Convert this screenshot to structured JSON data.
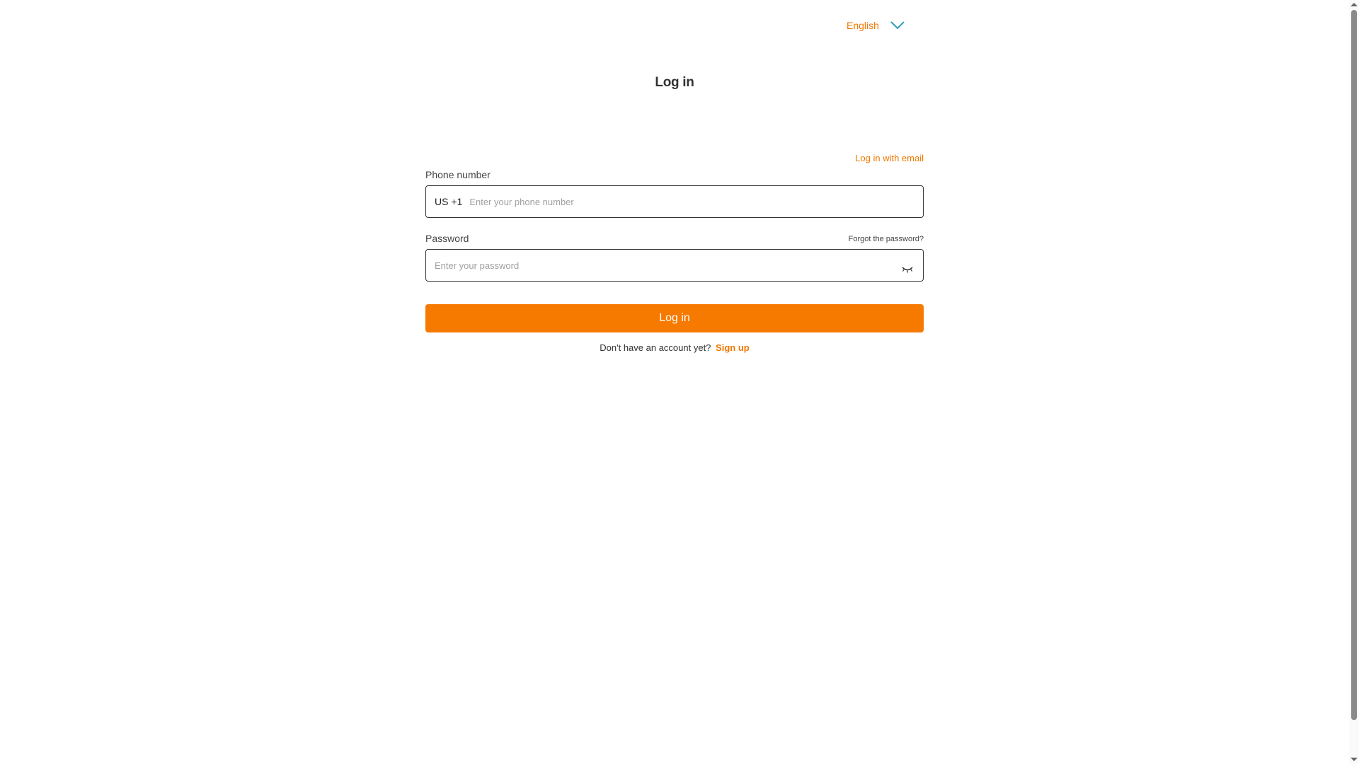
{
  "header": {
    "language": "English"
  },
  "title": "Log in",
  "form": {
    "switch_link": "Log in with email",
    "phone": {
      "label": "Phone number",
      "country_code": "US +1",
      "placeholder": "Enter your phone number",
      "value": ""
    },
    "password": {
      "label": "Password",
      "forgot_link": "Forgot the password?",
      "placeholder": "Enter your password",
      "value": ""
    },
    "submit_label": "Log in",
    "signup_prompt": "Don't have an account yet?",
    "signup_link": "Sign up"
  },
  "colors": {
    "accent": "#f77a00",
    "link": "#f07800",
    "chevron": "#2a9fc0"
  },
  "icons": {
    "language_toggle": "chevron-down-icon",
    "password_visibility": "eye-closed-icon"
  }
}
